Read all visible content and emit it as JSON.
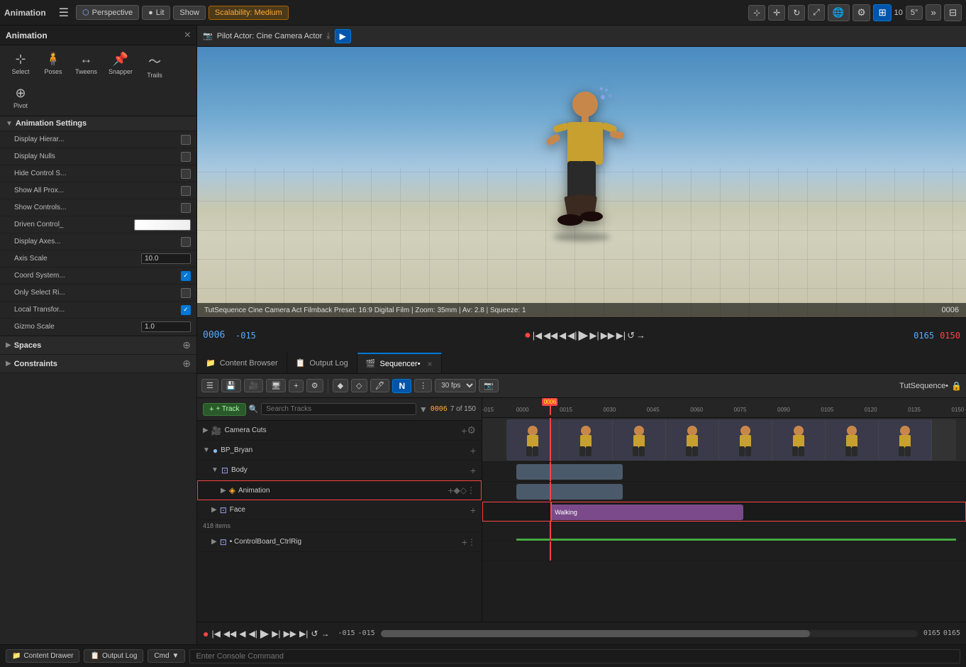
{
  "app": {
    "title": "Animation",
    "close_label": "×"
  },
  "top_toolbar": {
    "menu_icon": "☰",
    "perspective_label": "Perspective",
    "lit_label": "Lit",
    "show_label": "Show",
    "scalability_label": "Scalability: Medium",
    "pilot_actor_label": "Pilot Actor: Cine Camera Actor",
    "icon_count": "10",
    "angle_label": "5°"
  },
  "anim_tools": [
    {
      "id": "select",
      "label": "Select",
      "icon": "⊹"
    },
    {
      "id": "poses",
      "label": "Poses",
      "icon": "🧍"
    },
    {
      "id": "tweens",
      "label": "Tweens",
      "icon": "↔"
    },
    {
      "id": "snapper",
      "label": "Snapper",
      "icon": "📌"
    },
    {
      "id": "trails",
      "label": "Trails",
      "icon": "〜"
    },
    {
      "id": "pivot",
      "label": "Pivot",
      "icon": "⊕"
    }
  ],
  "settings": {
    "section_label": "Animation Settings",
    "rows": [
      {
        "id": "display-hier",
        "label": "Display Hierar...",
        "type": "checkbox",
        "checked": false
      },
      {
        "id": "display-nulls",
        "label": "Display Nulls",
        "type": "checkbox",
        "checked": false
      },
      {
        "id": "hide-control-s",
        "label": "Hide Control S...",
        "type": "checkbox",
        "checked": false
      },
      {
        "id": "show-all-prox",
        "label": "Show All Prox...",
        "type": "checkbox",
        "checked": false
      },
      {
        "id": "show-controls",
        "label": "Show Controls...",
        "type": "checkbox",
        "checked": false
      },
      {
        "id": "driven-control",
        "label": "Driven Control_",
        "type": "color",
        "value": "#ffffff"
      },
      {
        "id": "display-axes",
        "label": "Display Axes...",
        "type": "checkbox",
        "checked": false
      },
      {
        "id": "axis-scale",
        "label": "Axis Scale",
        "type": "input",
        "value": "10.0"
      },
      {
        "id": "coord-system",
        "label": "Coord System...",
        "type": "checkbox",
        "checked": true
      },
      {
        "id": "only-select-ri",
        "label": "Only Select Ri...",
        "type": "checkbox",
        "checked": false
      },
      {
        "id": "local-transfor",
        "label": "Local Transfor...",
        "type": "checkbox",
        "checked": true
      },
      {
        "id": "gizmo-scale",
        "label": "Gizmo Scale",
        "type": "input",
        "value": "1.0"
      }
    ],
    "spaces_label": "Spaces",
    "constraints_label": "Constraints"
  },
  "viewport": {
    "info_text": "TutSequence  Cine Camera Act Filmback Preset: 16:9 Digital Film | Zoom: 35mm | Av: 2.8 | Squeeze: 1",
    "frame_label": "0006"
  },
  "timeline": {
    "current_frame": "0006",
    "start_frame": "-015",
    "end_frame": "0165",
    "red_end": "0150",
    "play_icon": "▶",
    "stop_icon": "⏹",
    "prev_icon": "◀◀",
    "next_icon": "▶▶",
    "record_color": "#ff4444"
  },
  "tabs": [
    {
      "id": "content-browser",
      "label": "Content Browser",
      "icon": "📁",
      "active": false
    },
    {
      "id": "output-log",
      "label": "Output Log",
      "icon": "📋",
      "active": false
    },
    {
      "id": "sequencer",
      "label": "Sequencer•",
      "icon": "🎬",
      "active": true
    }
  ],
  "sequencer": {
    "title": "TutSequence•",
    "fps_label": "30 fps",
    "add_track_label": "+ Track",
    "search_placeholder": "Search Tracks",
    "frame_label": "0006",
    "count_label": "7 of 150",
    "tracks": [
      {
        "id": "camera-cuts",
        "label": "Camera Cuts",
        "indent": 0,
        "type": "camera",
        "has_add": true
      },
      {
        "id": "bp-bryan",
        "label": "BP_Bryan",
        "indent": 0,
        "type": "group",
        "collapsed": false,
        "has_add": true
      },
      {
        "id": "body",
        "label": "Body",
        "indent": 1,
        "type": "group",
        "collapsed": false,
        "has_add": true
      },
      {
        "id": "animation",
        "label": "Animation",
        "indent": 2,
        "type": "anim",
        "selected": true,
        "has_add": true
      },
      {
        "id": "face",
        "label": "Face",
        "indent": 1,
        "type": "group",
        "has_add": true
      },
      {
        "id": "control-board",
        "label": "• ControlBoard_CtrlRig",
        "indent": 1,
        "type": "rig",
        "has_add": true
      }
    ],
    "items_count": "418 items",
    "timeline_markers": [
      "-015",
      "0000",
      "0015",
      "0030",
      "0045",
      "0060",
      "0075",
      "0090",
      "0105",
      "0120",
      "0135",
      "0150"
    ],
    "walking_block_label": "Walking",
    "scroll_left": "-015",
    "scroll_right": "0165",
    "scroll_left2": "-015"
  },
  "status_bar": {
    "content_drawer_label": "Content Drawer",
    "output_log_label": "Output Log",
    "cmd_label": "Cmd",
    "console_placeholder": "Enter Console Command",
    "lock_icon": "🔒"
  }
}
